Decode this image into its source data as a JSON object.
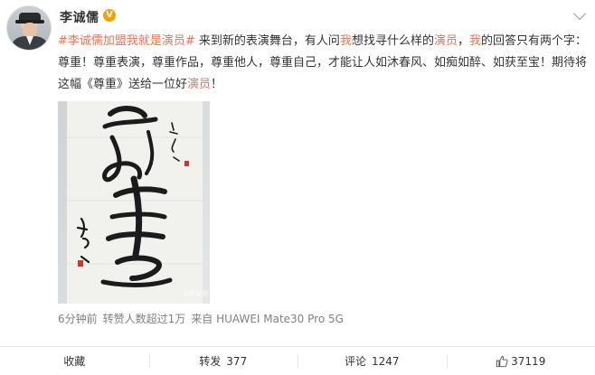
{
  "post": {
    "username": "李诚儒",
    "verified_badge": "V",
    "text_parts": [
      {
        "text": "#李诚儒加盟我就是演员#",
        "style": "tag"
      },
      {
        "text": " 来到新的表演舞台，有人问",
        "style": "normal"
      },
      {
        "text": "我",
        "style": "hl"
      },
      {
        "text": "想找寻什么样的",
        "style": "normal"
      },
      {
        "text": "演员",
        "style": "hl"
      },
      {
        "text": "，",
        "style": "normal"
      },
      {
        "text": "我",
        "style": "hl"
      },
      {
        "text": "的回答只有两个字：尊重！尊重表演，尊重作品，尊重他人，尊重自己，才能让人如沐春风、如痴如醉、如获至宝！期待将这幅《尊重》送给一位好",
        "style": "normal"
      },
      {
        "text": "演员",
        "style": "hl"
      },
      {
        "text": "！",
        "style": "normal"
      }
    ],
    "image_watermark": "@李诚儒",
    "meta": {
      "time": "6分钟前",
      "reposts_note": "转赞人数超过1万",
      "source": "来自 HUAWEI Mate30 Pro 5G"
    }
  },
  "actions": {
    "favorite": {
      "label": "收藏"
    },
    "repost": {
      "label": "转发",
      "count": "377"
    },
    "comment": {
      "label": "评论",
      "count": "1247"
    },
    "like": {
      "count": "37119"
    }
  },
  "icons": {
    "verified": "verified-v-badge-icon",
    "more": "chevron-down-icon",
    "like": "thumbs-up-icon"
  },
  "colors": {
    "accent": "#eb7350",
    "badge": "#f7a000",
    "meta": "#808080"
  }
}
